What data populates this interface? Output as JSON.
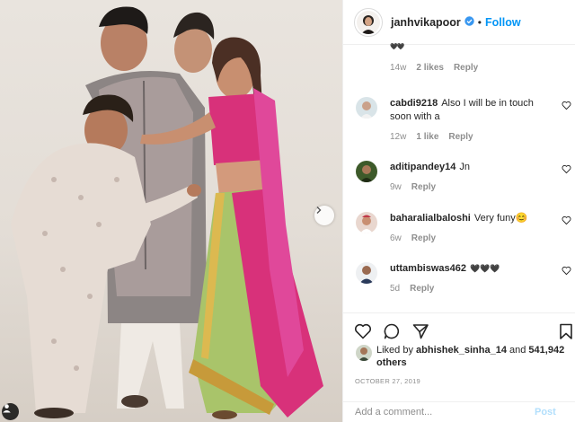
{
  "post": {
    "author": "janhvikapoor",
    "follow_label": "Follow",
    "separator": "•"
  },
  "fragment": {
    "text": "🖤🖤",
    "age": "14w",
    "likes": "2 likes",
    "reply": "Reply"
  },
  "comments": [
    {
      "user": "cabdi9218",
      "text": "Also I will be in touch soon with a",
      "age": "12w",
      "likes": "1 like",
      "reply": "Reply"
    },
    {
      "user": "aditipandey14",
      "text": "Jn",
      "age": "9w",
      "likes": "",
      "reply": "Reply"
    },
    {
      "user": "baharalialbaloshi",
      "text": "Very funy😊",
      "age": "6w",
      "likes": "",
      "reply": "Reply"
    },
    {
      "user": "uttambiswas462",
      "text": "🖤🖤🖤",
      "age": "5d",
      "likes": "",
      "reply": "Reply"
    }
  ],
  "likes_summary": {
    "prefix": "Liked by",
    "user": "abhishek_sinha_14",
    "and": "and",
    "count": "541,942 others"
  },
  "date": "OCTOBER 27, 2019",
  "composer": {
    "placeholder": "Add a comment...",
    "post_label": "Post"
  },
  "colors": {
    "accent": "#0095f6",
    "muted": "#8e8e8e",
    "saree_pink": "#d8317a",
    "saree_green": "#a9c46a"
  },
  "icons": [
    "verified-badge-icon",
    "heart-icon",
    "comment-icon",
    "share-icon",
    "bookmark-icon",
    "chevron-right-icon",
    "person-tag-icon"
  ]
}
